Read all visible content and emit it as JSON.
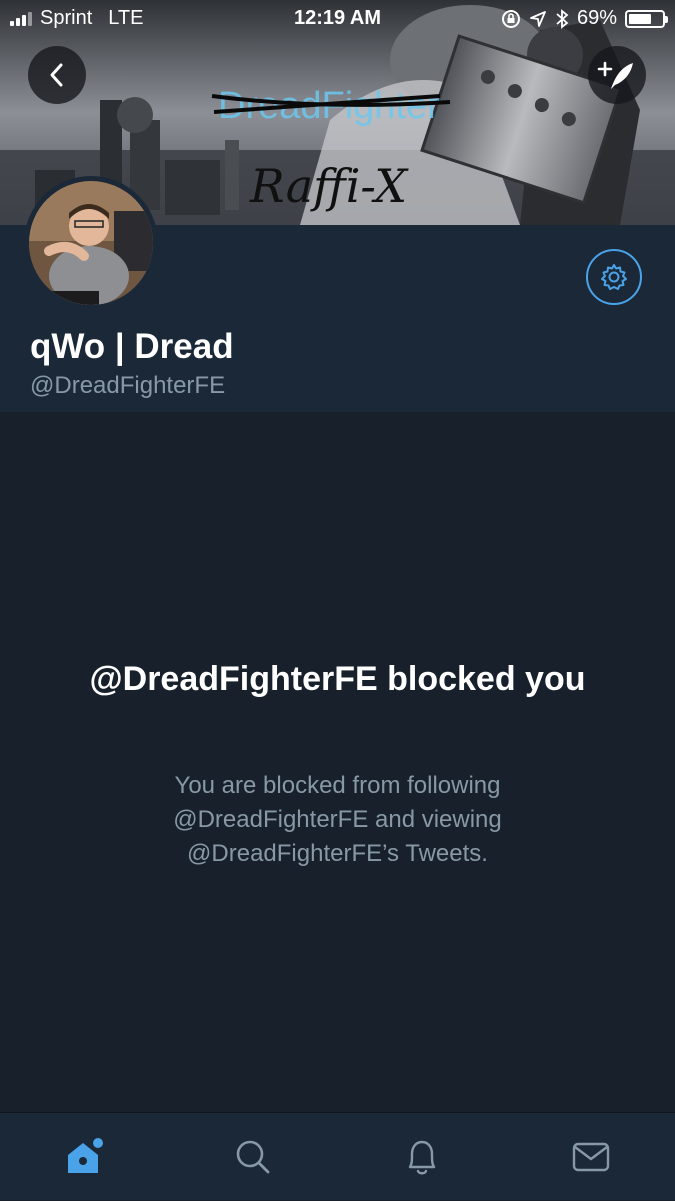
{
  "status_bar": {
    "carrier": "Sprint",
    "network": "LTE",
    "time": "12:19 AM",
    "battery_percent_label": "69%",
    "battery_level": 0.69
  },
  "banner": {
    "logo_text_struck": "DreadFighter",
    "handwritten_text": "Raffi-X"
  },
  "profile": {
    "display_name": "qWo | Dread",
    "handle": "@DreadFighterFE"
  },
  "blocked": {
    "title": "@DreadFighterFE blocked you",
    "description": "You are blocked from following @DreadFighterFE and viewing @DreadFighterFE’s Tweets."
  },
  "tab_bar": {
    "tabs": [
      {
        "name": "home",
        "icon": "home-icon",
        "active": true
      },
      {
        "name": "search",
        "icon": "search-icon",
        "active": false
      },
      {
        "name": "notifications",
        "icon": "bell-icon",
        "active": false
      },
      {
        "name": "messages",
        "icon": "envelope-icon",
        "active": false
      }
    ]
  },
  "colors": {
    "background": "#17202b",
    "profile_panel": "#1b2838",
    "accent": "#4aa3e8",
    "secondary_text": "#8899a6"
  }
}
